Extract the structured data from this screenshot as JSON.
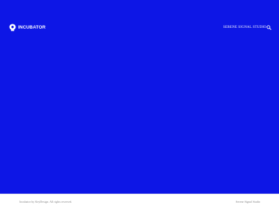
{
  "header": {
    "logo_text": "INCUBATOR",
    "nav_link": "SERENE SIGNAL STUDIO",
    "search_icon": "search-icon"
  },
  "hero": {
    "background_color": "#0d16e6"
  },
  "footer": {
    "copyright": "Incubator by KeyDesign. All rights reserved.",
    "site_name": "Serene Signal Studio"
  },
  "colors": {
    "accent": "#0d16e6",
    "text_on_accent": "#ffffff",
    "footer_text": "#888888"
  }
}
